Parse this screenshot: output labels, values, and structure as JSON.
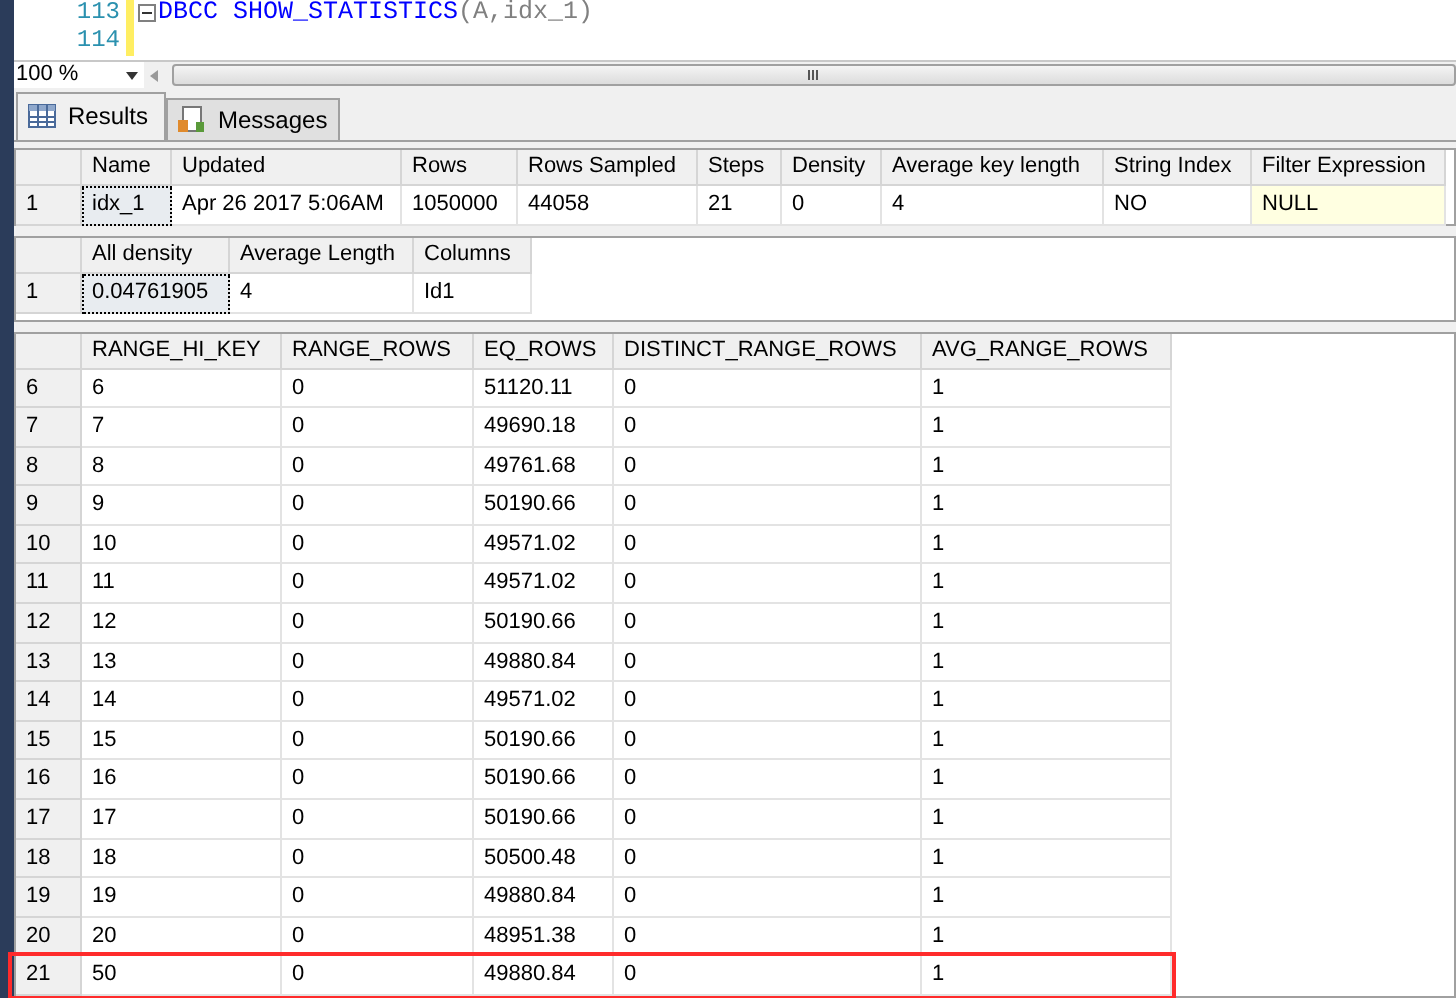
{
  "editor": {
    "lines": [
      {
        "number": "113",
        "tokens": [
          {
            "kind": "keyword",
            "text": "DBCC"
          },
          {
            "kind": "keyword",
            "text": " SHOW_STATISTICS"
          },
          {
            "kind": "plain",
            "text": "(A,idx_1)"
          }
        ]
      },
      {
        "number": "114"
      }
    ]
  },
  "zoom": {
    "value": "100 %"
  },
  "tabs": [
    {
      "label": "Results",
      "selected": true
    },
    {
      "label": "Messages",
      "selected": false
    }
  ],
  "grids": [
    {
      "columns": [
        "Name",
        "Updated",
        "Rows",
        "Rows Sampled",
        "Steps",
        "Density",
        "Average key length",
        "String Index",
        "Filter Expression"
      ],
      "rows": [
        {
          "number": "1",
          "cells": [
            {
              "text": "idx_1",
              "selected": true
            },
            {
              "text": "Apr 26 2017  5:06AM",
              "selected": false
            },
            {
              "text": "1050000",
              "selected": false
            },
            {
              "text": "44058",
              "selected": false
            },
            {
              "text": "21",
              "selected": false
            },
            {
              "text": "0",
              "selected": false
            },
            {
              "text": "4",
              "selected": false
            },
            {
              "text": "NO",
              "selected": false
            },
            {
              "text": "NULL",
              "selected": false,
              "kind": "null"
            }
          ]
        }
      ]
    },
    {
      "columns": [
        "All density",
        "Average Length",
        "Columns"
      ],
      "rows": [
        {
          "number": "1",
          "cells": [
            {
              "text": "0.04761905",
              "selected": true
            },
            {
              "text": "4",
              "selected": false
            },
            {
              "text": "Id1",
              "selected": false
            }
          ]
        }
      ]
    },
    {
      "columns": [
        "RANGE_HI_KEY",
        "RANGE_ROWS",
        "EQ_ROWS",
        "DISTINCT_RANGE_ROWS",
        "AVG_RANGE_ROWS"
      ],
      "rows": [
        {
          "number": "6",
          "highlighted": false,
          "cells": [
            {
              "text": "6"
            },
            {
              "text": "0"
            },
            {
              "text": "51120.11"
            },
            {
              "text": "0"
            },
            {
              "text": "1"
            }
          ]
        },
        {
          "number": "7",
          "highlighted": false,
          "cells": [
            {
              "text": "7"
            },
            {
              "text": "0"
            },
            {
              "text": "49690.18"
            },
            {
              "text": "0"
            },
            {
              "text": "1"
            }
          ]
        },
        {
          "number": "8",
          "highlighted": false,
          "cells": [
            {
              "text": "8"
            },
            {
              "text": "0"
            },
            {
              "text": "49761.68"
            },
            {
              "text": "0"
            },
            {
              "text": "1"
            }
          ]
        },
        {
          "number": "9",
          "highlighted": false,
          "cells": [
            {
              "text": "9"
            },
            {
              "text": "0"
            },
            {
              "text": "50190.66"
            },
            {
              "text": "0"
            },
            {
              "text": "1"
            }
          ]
        },
        {
          "number": "10",
          "highlighted": false,
          "cells": [
            {
              "text": "10"
            },
            {
              "text": "0"
            },
            {
              "text": "49571.02"
            },
            {
              "text": "0"
            },
            {
              "text": "1"
            }
          ]
        },
        {
          "number": "11",
          "highlighted": false,
          "cells": [
            {
              "text": "11"
            },
            {
              "text": "0"
            },
            {
              "text": "49571.02"
            },
            {
              "text": "0"
            },
            {
              "text": "1"
            }
          ]
        },
        {
          "number": "12",
          "highlighted": false,
          "cells": [
            {
              "text": "12"
            },
            {
              "text": "0"
            },
            {
              "text": "50190.66"
            },
            {
              "text": "0"
            },
            {
              "text": "1"
            }
          ]
        },
        {
          "number": "13",
          "highlighted": false,
          "cells": [
            {
              "text": "13"
            },
            {
              "text": "0"
            },
            {
              "text": "49880.84"
            },
            {
              "text": "0"
            },
            {
              "text": "1"
            }
          ]
        },
        {
          "number": "14",
          "highlighted": false,
          "cells": [
            {
              "text": "14"
            },
            {
              "text": "0"
            },
            {
              "text": "49571.02"
            },
            {
              "text": "0"
            },
            {
              "text": "1"
            }
          ]
        },
        {
          "number": "15",
          "highlighted": false,
          "cells": [
            {
              "text": "15"
            },
            {
              "text": "0"
            },
            {
              "text": "50190.66"
            },
            {
              "text": "0"
            },
            {
              "text": "1"
            }
          ]
        },
        {
          "number": "16",
          "highlighted": false,
          "cells": [
            {
              "text": "16"
            },
            {
              "text": "0"
            },
            {
              "text": "50190.66"
            },
            {
              "text": "0"
            },
            {
              "text": "1"
            }
          ]
        },
        {
          "number": "17",
          "highlighted": false,
          "cells": [
            {
              "text": "17"
            },
            {
              "text": "0"
            },
            {
              "text": "50190.66"
            },
            {
              "text": "0"
            },
            {
              "text": "1"
            }
          ]
        },
        {
          "number": "18",
          "highlighted": false,
          "cells": [
            {
              "text": "18"
            },
            {
              "text": "0"
            },
            {
              "text": "50500.48"
            },
            {
              "text": "0"
            },
            {
              "text": "1"
            }
          ]
        },
        {
          "number": "19",
          "highlighted": false,
          "cells": [
            {
              "text": "19"
            },
            {
              "text": "0"
            },
            {
              "text": "49880.84"
            },
            {
              "text": "0"
            },
            {
              "text": "1"
            }
          ]
        },
        {
          "number": "20",
          "highlighted": false,
          "cells": [
            {
              "text": "20"
            },
            {
              "text": "0"
            },
            {
              "text": "48951.38"
            },
            {
              "text": "0"
            },
            {
              "text": "1"
            }
          ]
        },
        {
          "number": "21",
          "highlighted": true,
          "cells": [
            {
              "text": "50"
            },
            {
              "text": "0"
            },
            {
              "text": "49880.84"
            },
            {
              "text": "0"
            },
            {
              "text": "1"
            }
          ]
        }
      ]
    }
  ]
}
